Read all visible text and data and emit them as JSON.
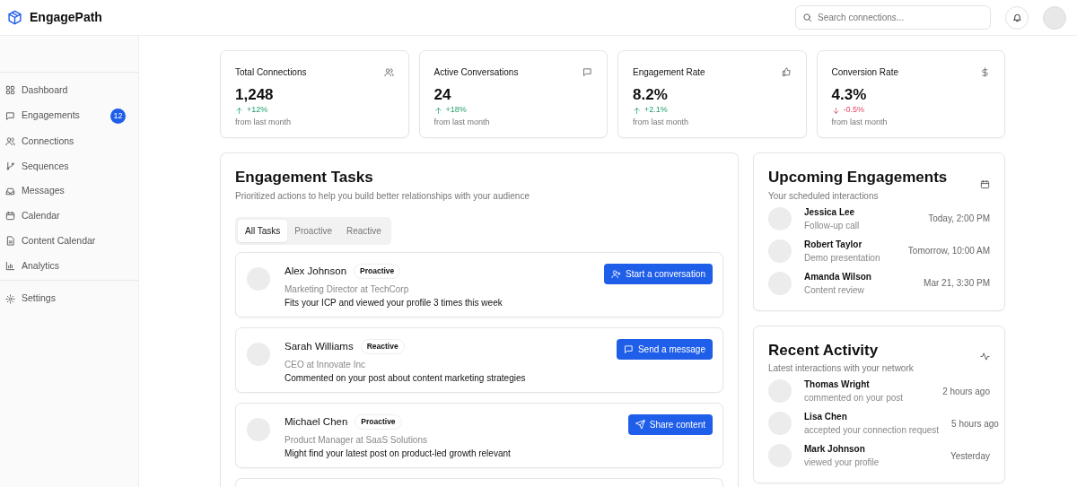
{
  "app": {
    "name": "EngagePath"
  },
  "header": {
    "search": {
      "placeholder": "Search connections..."
    }
  },
  "sidebar": {
    "items": [
      {
        "label": "Dashboard",
        "selected": false
      },
      {
        "label": "Engagements",
        "selected": false,
        "badge": "12"
      },
      {
        "label": "Connections",
        "selected": false
      },
      {
        "label": "Sequences",
        "selected": false
      },
      {
        "label": "Messages",
        "selected": false
      },
      {
        "label": "Calendar",
        "selected": false
      },
      {
        "label": "Content Calendar",
        "selected": false
      },
      {
        "label": "Analytics",
        "selected": false
      }
    ],
    "footer_items": [
      {
        "label": "Settings",
        "selected": false
      }
    ]
  },
  "stats": [
    {
      "title": "Total Connections",
      "value": "1,248",
      "change": "+12%",
      "kind": "rise",
      "note": "from last month"
    },
    {
      "title": "Active Conversations",
      "value": "24",
      "change": "+18%",
      "kind": "rise",
      "note": "from last month"
    },
    {
      "title": "Engagement Rate",
      "value": "8.2%",
      "change": "+2.1%",
      "kind": "rise",
      "note": "from last month"
    },
    {
      "title": "Conversion Rate",
      "value": "4.3%",
      "change": "-0.5%",
      "kind": "fall",
      "note": "from last month"
    }
  ],
  "tasks": {
    "title": "Engagement Tasks",
    "subtitle": "Prioritized actions to help you build better relationships with your audience",
    "tabs": [
      {
        "label": "All Tasks",
        "selected": true
      },
      {
        "label": "Proactive",
        "selected": false
      },
      {
        "label": "Reactive",
        "selected": false
      }
    ],
    "items": [
      {
        "kind": "full",
        "name": "Alex Johnson",
        "tag": "Proactive",
        "role": "Marketing Director at TechCorp",
        "reason": "Fits your ICP and viewed your profile 3 times this week",
        "action": "Start a conversation"
      },
      {
        "kind": "full",
        "name": "Sarah Williams",
        "tag": "Reactive",
        "role": "CEO at Innovate Inc",
        "reason": "Commented on your post about content marketing strategies",
        "action": "Send a message"
      },
      {
        "kind": "full",
        "name": "Michael Chen",
        "tag": "Proactive",
        "role": "Product Manager at SaaS Solutions",
        "reason": "Might find your latest post on product-led growth relevant",
        "action": "Share content"
      },
      {
        "kind": "cut_off"
      }
    ]
  },
  "upcoming": {
    "title": "Upcoming Engagements",
    "subtitle": "Your scheduled interactions",
    "items": [
      {
        "name": "Jessica Lee",
        "detail": "Follow-up call",
        "time": "Today, 2:00 PM"
      },
      {
        "name": "Robert Taylor",
        "detail": "Demo presentation",
        "time": "Tomorrow, 10:00 AM"
      },
      {
        "name": "Amanda Wilson",
        "detail": "Content review",
        "time": "Mar 21, 3:30 PM"
      }
    ]
  },
  "activity": {
    "title": "Recent Activity",
    "subtitle": "Latest interactions with your network",
    "items": [
      {
        "name": "Thomas Wright",
        "detail": "commented on your post",
        "time": "2 hours ago"
      },
      {
        "name": "Lisa Chen",
        "detail": "accepted your connection request",
        "time": "5 hours ago"
      },
      {
        "name": "Mark Johnson",
        "detail": "viewed your profile",
        "time": "Yesterday"
      }
    ]
  }
}
